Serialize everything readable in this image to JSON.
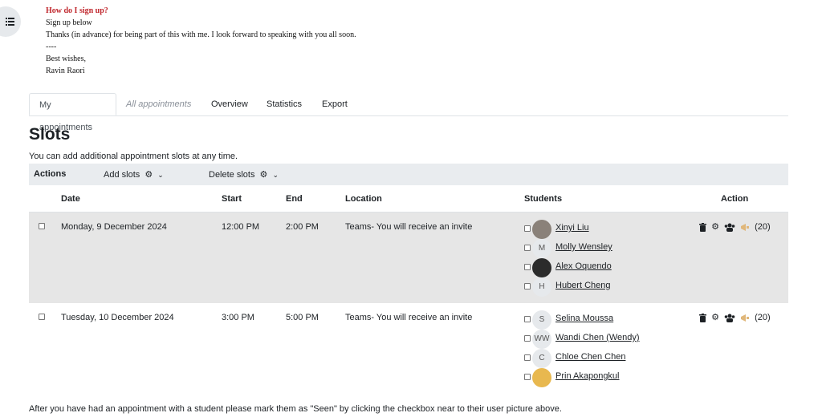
{
  "intro": {
    "question": "How do I sign up?",
    "lines": [
      "Sign up below",
      "Thanks (in advance) for being part of this with me. I look forward to speaking with you all soon.",
      "----",
      "Best wishes,",
      "Ravin Raori"
    ]
  },
  "tabs": [
    "My appointments",
    "All appointments",
    "Overview",
    "Statistics",
    "Export"
  ],
  "slots_heading": "Slots",
  "slots_note": "You can add additional appointment slots at any time.",
  "actions": {
    "label": "Actions",
    "add_slots": "Add slots",
    "delete_slots": "Delete slots"
  },
  "table": {
    "headers": {
      "date": "Date",
      "start": "Start",
      "end": "End",
      "location": "Location",
      "students": "Students",
      "action": "Action"
    },
    "rows": [
      {
        "date": "Monday, 9 December 2024",
        "start": "12:00 PM",
        "end": "2:00 PM",
        "location": "Teams- You will receive an invite",
        "count": "(20)",
        "students": [
          {
            "name": "Xinyi Liu",
            "initials": ""
          },
          {
            "name": "Molly Wensley",
            "initials": "M"
          },
          {
            "name": "Alex Oquendo",
            "initials": ""
          },
          {
            "name": "Hubert Cheng",
            "initials": "H"
          }
        ]
      },
      {
        "date": "Tuesday, 10 December 2024",
        "start": "3:00 PM",
        "end": "5:00 PM",
        "location": "Teams- You will receive an invite",
        "count": "(20)",
        "students": [
          {
            "name": "Selina Moussa",
            "initials": "S"
          },
          {
            "name": "Wandi Chen (Wendy)",
            "initials": "WW"
          },
          {
            "name": "Chloe Chen Chen",
            "initials": "C"
          },
          {
            "name": "Prin Akapongkul",
            "initials": ""
          }
        ]
      }
    ]
  },
  "footer_note": "After you have had an appointment with a student please mark them as \"Seen\" by clicking the checkbox near to their user picture above.",
  "colors": {
    "accent_red": "#c0272d",
    "row_grey": "#e6e6e6",
    "bar_grey": "#e9ecef"
  }
}
